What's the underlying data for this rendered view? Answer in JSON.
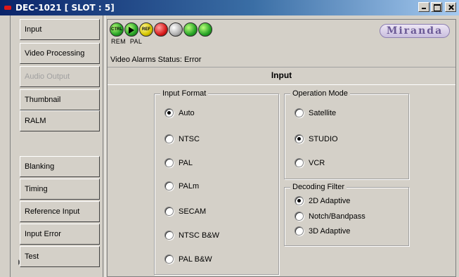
{
  "window": {
    "title": "DEC-1021 [ SLOT : 5]",
    "minimize_label": "",
    "maximize_label": "",
    "close_label": ""
  },
  "sidenav": {
    "items": [
      {
        "label": "Input",
        "enabled": true
      },
      {
        "label": "Video Processing",
        "enabled": true
      },
      {
        "label": "Audio Output",
        "enabled": false
      },
      {
        "label": "Thumbnail",
        "enabled": true
      },
      {
        "label": "RALM",
        "enabled": true
      },
      {
        "label": "",
        "enabled": false
      },
      {
        "label": "Blanking",
        "enabled": true
      },
      {
        "label": "Timing",
        "enabled": true
      },
      {
        "label": "Reference Input",
        "enabled": true
      },
      {
        "label": "Input Error",
        "enabled": true
      },
      {
        "label": "Test",
        "enabled": true
      }
    ]
  },
  "status_icons": {
    "ctrl": "CTRL",
    "ref": "REF",
    "sub_labels": [
      "REM",
      "PAL"
    ]
  },
  "logo": "Miranda",
  "video_alarms_status": "Video Alarms Status: Error",
  "panel_title": "Input",
  "input_format": {
    "legend": "Input Format",
    "options": [
      "Auto",
      "NTSC",
      "PAL",
      "PALm",
      "SECAM",
      "NTSC B&W",
      "PAL B&W"
    ],
    "selected": "Auto"
  },
  "operation_mode": {
    "legend": "Operation Mode",
    "options": [
      "Satellite",
      "STUDIO",
      "VCR"
    ],
    "selected": "STUDIO"
  },
  "decoding_filter": {
    "legend": "Decoding Filter",
    "options": [
      "2D Adaptive",
      "Notch/Bandpass",
      "3D Adaptive"
    ],
    "selected": "2D Adaptive"
  }
}
